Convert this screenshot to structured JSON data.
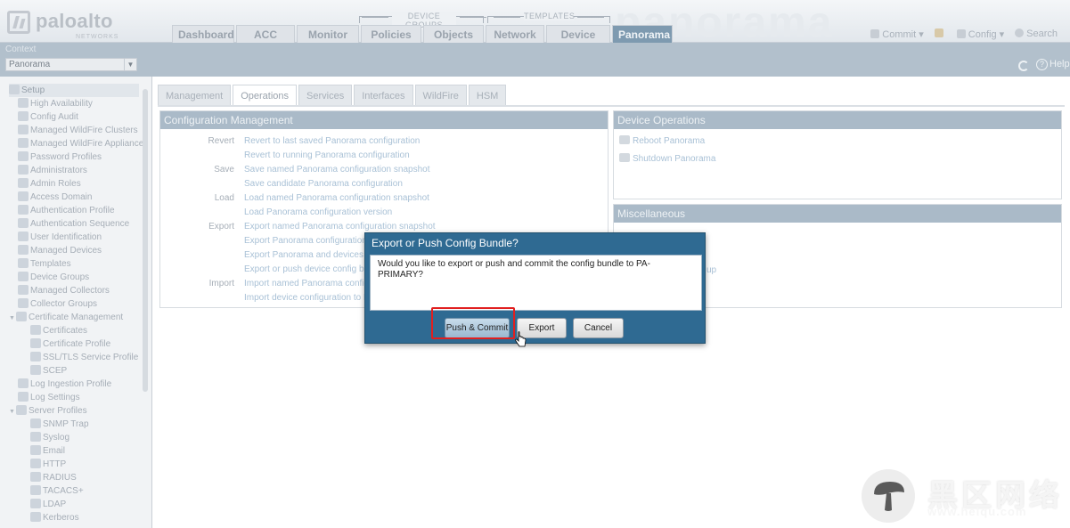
{
  "header": {
    "brand": "paloalto",
    "brand_sub": "NETWORKS",
    "bg_watermark": "panorama",
    "group_device_groups": "DEVICE GROUPS",
    "group_templates": "TEMPLATES",
    "tabs": [
      {
        "label": "Dashboard"
      },
      {
        "label": "ACC"
      },
      {
        "label": "Monitor"
      },
      {
        "label": "Policies"
      },
      {
        "label": "Objects"
      },
      {
        "label": "Network"
      },
      {
        "label": "Device"
      },
      {
        "label": "Panorama"
      }
    ],
    "commit": "Commit",
    "config": "Config",
    "search": "Search"
  },
  "context": {
    "label": "Context",
    "value": "Panorama",
    "help": "Help"
  },
  "sidebar": {
    "items": [
      {
        "label": "Setup"
      },
      {
        "label": "High Availability"
      },
      {
        "label": "Config Audit"
      },
      {
        "label": "Managed WildFire Clusters"
      },
      {
        "label": "Managed WildFire Appliances"
      },
      {
        "label": "Password Profiles"
      },
      {
        "label": "Administrators"
      },
      {
        "label": "Admin Roles"
      },
      {
        "label": "Access Domain"
      },
      {
        "label": "Authentication Profile"
      },
      {
        "label": "Authentication Sequence"
      },
      {
        "label": "User Identification"
      },
      {
        "label": "Managed Devices"
      },
      {
        "label": "Templates"
      },
      {
        "label": "Device Groups"
      },
      {
        "label": "Managed Collectors"
      },
      {
        "label": "Collector Groups"
      },
      {
        "label": "Certificate Management"
      },
      {
        "label": "Certificates"
      },
      {
        "label": "Certificate Profile"
      },
      {
        "label": "SSL/TLS Service Profile"
      },
      {
        "label": "SCEP"
      },
      {
        "label": "Log Ingestion Profile"
      },
      {
        "label": "Log Settings"
      },
      {
        "label": "Server Profiles"
      },
      {
        "label": "SNMP Trap"
      },
      {
        "label": "Syslog"
      },
      {
        "label": "Email"
      },
      {
        "label": "HTTP"
      },
      {
        "label": "RADIUS"
      },
      {
        "label": "TACACS+"
      },
      {
        "label": "LDAP"
      },
      {
        "label": "Kerberos"
      }
    ]
  },
  "subtabs": [
    {
      "label": "Management"
    },
    {
      "label": "Operations"
    },
    {
      "label": "Services"
    },
    {
      "label": "Interfaces"
    },
    {
      "label": "WildFire"
    },
    {
      "label": "HSM"
    }
  ],
  "config_mgmt": {
    "title": "Configuration Management",
    "rows": [
      {
        "label": "Revert",
        "link": "Revert to last saved Panorama configuration"
      },
      {
        "label": "",
        "link": "Revert to running Panorama configuration"
      },
      {
        "label": "Save",
        "link": "Save named Panorama configuration snapshot"
      },
      {
        "label": "",
        "link": "Save candidate Panorama configuration"
      },
      {
        "label": "Load",
        "link": "Load named Panorama configuration snapshot"
      },
      {
        "label": "",
        "link": "Load Panorama configuration version"
      },
      {
        "label": "Export",
        "link": "Export named Panorama configuration snapshot"
      },
      {
        "label": "",
        "link": "Export Panorama configuration v"
      },
      {
        "label": "",
        "link": "Export Panorama and devices conf"
      },
      {
        "label": "",
        "link": "Export or push device config bun"
      },
      {
        "label": "Import",
        "link": "Import named Panorama configur"
      },
      {
        "label": "",
        "link": "Import device configuration to Pa"
      }
    ]
  },
  "device_ops": {
    "title": "Device Operations",
    "reboot": "Reboot Panorama",
    "shutdown": "Shutdown Panorama"
  },
  "misc": {
    "title": "Miscellaneous",
    "partial": "up"
  },
  "dialog": {
    "title": "Export or Push Config Bundle?",
    "message": "Would you like to export or push and commit the config bundle to PA-PRIMARY?",
    "push_commit": "Push & Commit",
    "export": "Export",
    "cancel": "Cancel"
  },
  "watermark": {
    "cn": "黑区网络",
    "url": "www.heiqu.com"
  },
  "colors": {
    "accent_tab": "#7e9ab0",
    "dialog_bg": "#2f6a92",
    "highlight": "#e11f1f"
  }
}
